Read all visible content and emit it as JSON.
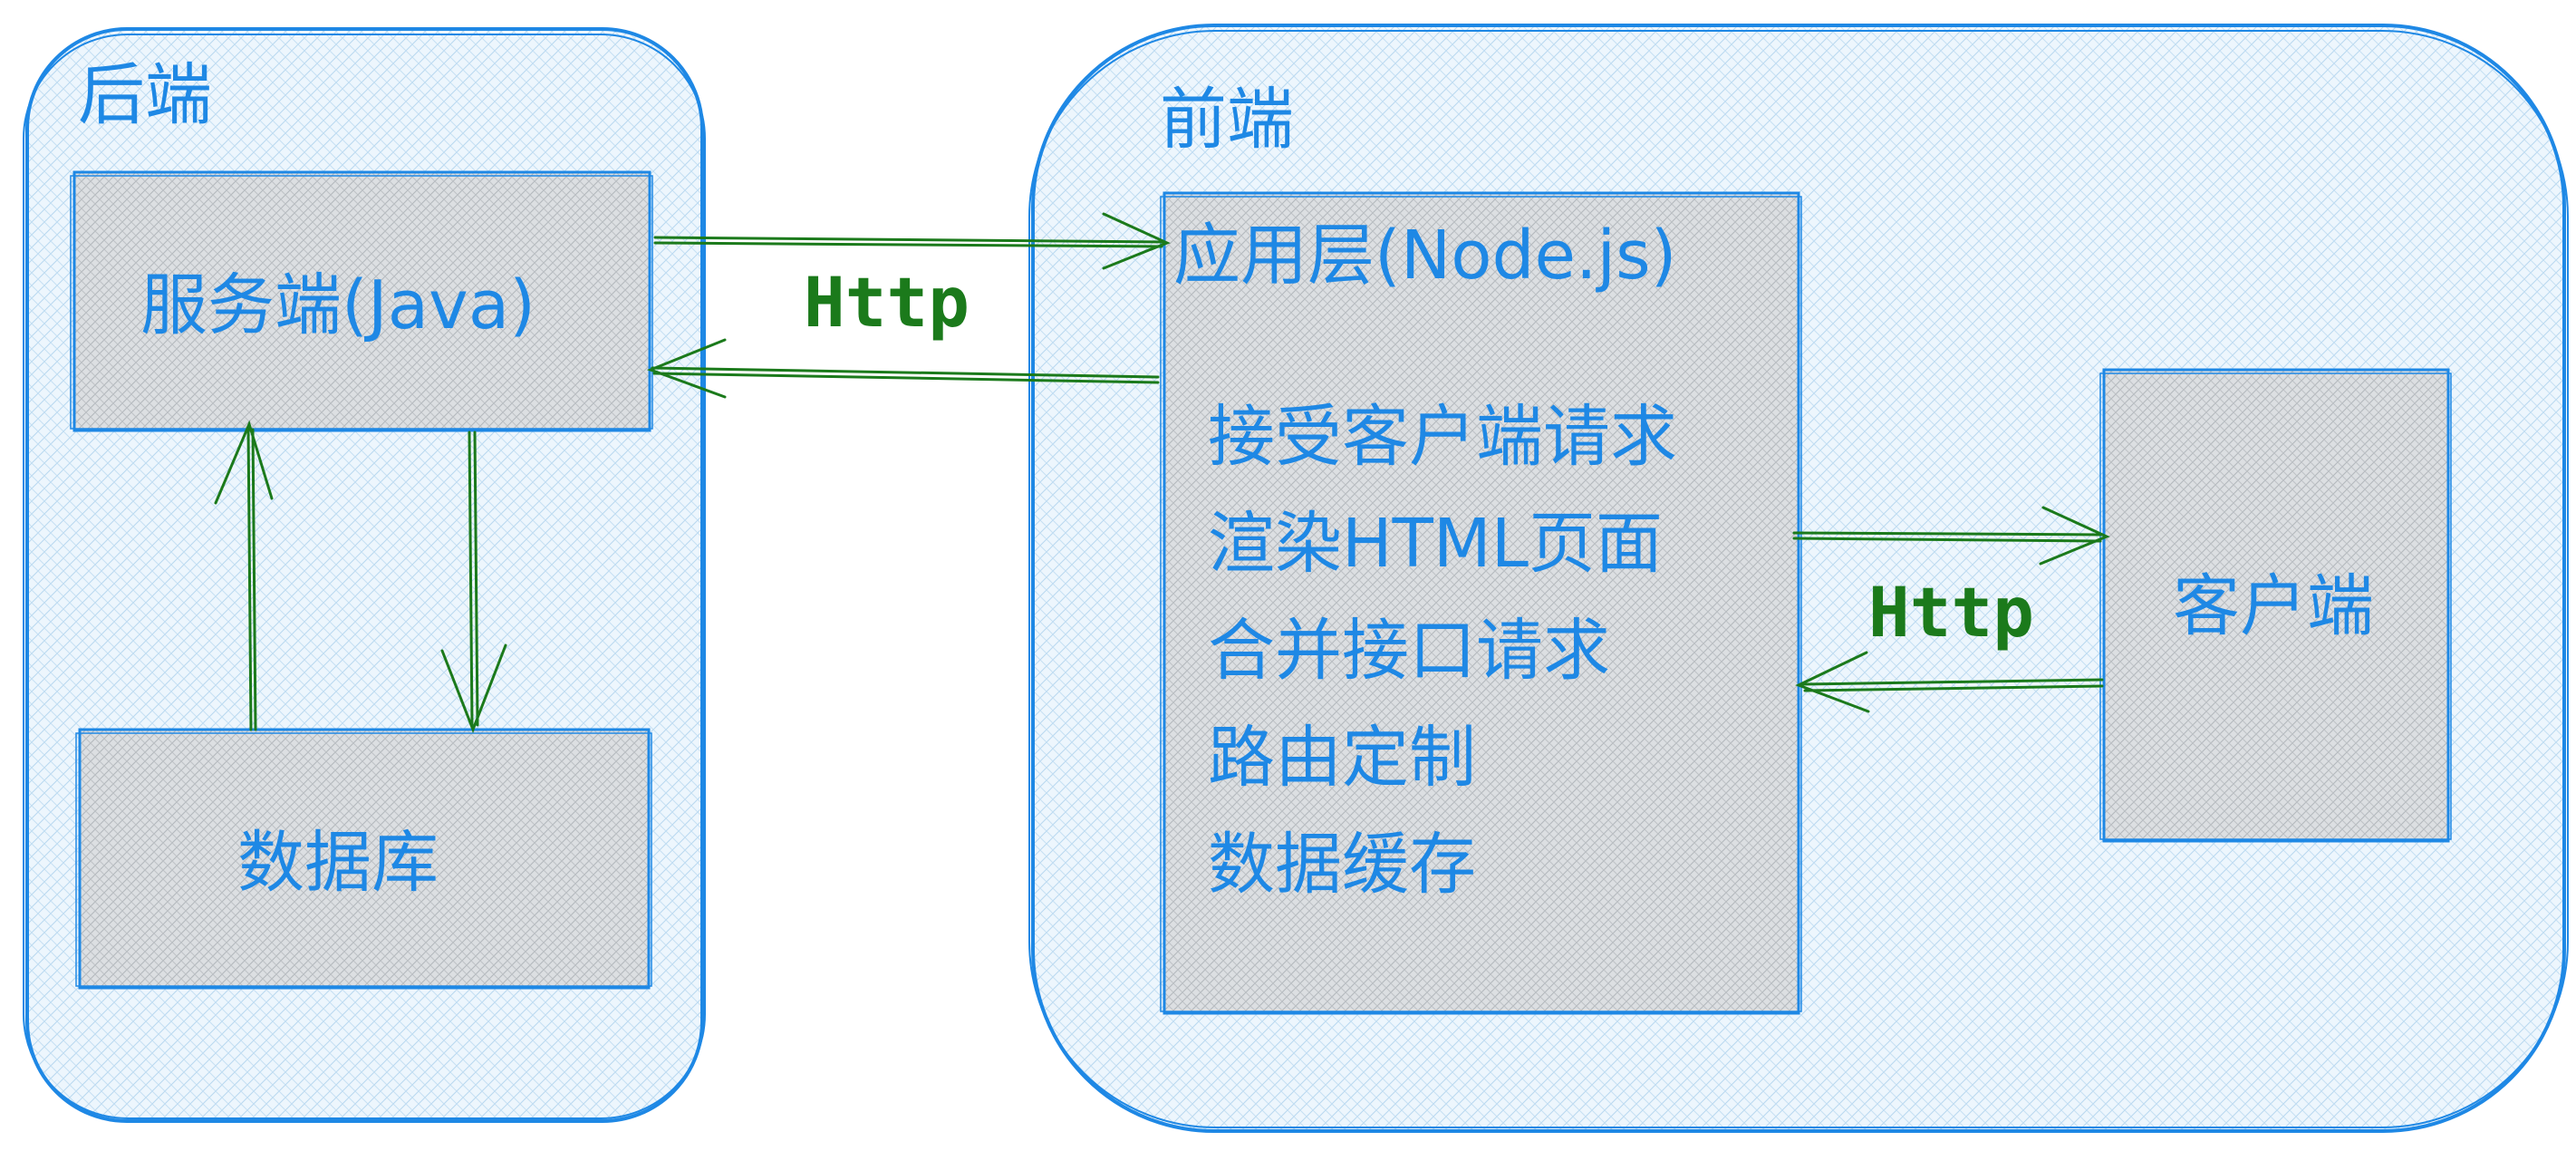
{
  "colors": {
    "container_stroke": "#1e88e5",
    "container_fill": "#e8f4fc",
    "box_fill": "#d5d9dd",
    "text_blue": "#1e88e5",
    "arrow_green": "#1b7a1b"
  },
  "backend": {
    "title": "后端",
    "server": "服务端(Java)",
    "database": "数据库"
  },
  "frontend": {
    "title": "前端",
    "app_layer": {
      "title": "应用层(Node.js)",
      "items": [
        "接受客户端请求",
        "渲染HTML页面",
        "合并接口请求",
        "路由定制",
        "数据缓存"
      ]
    },
    "client": "客户端"
  },
  "connections": {
    "backend_frontend": "Http",
    "frontend_client": "Http"
  }
}
